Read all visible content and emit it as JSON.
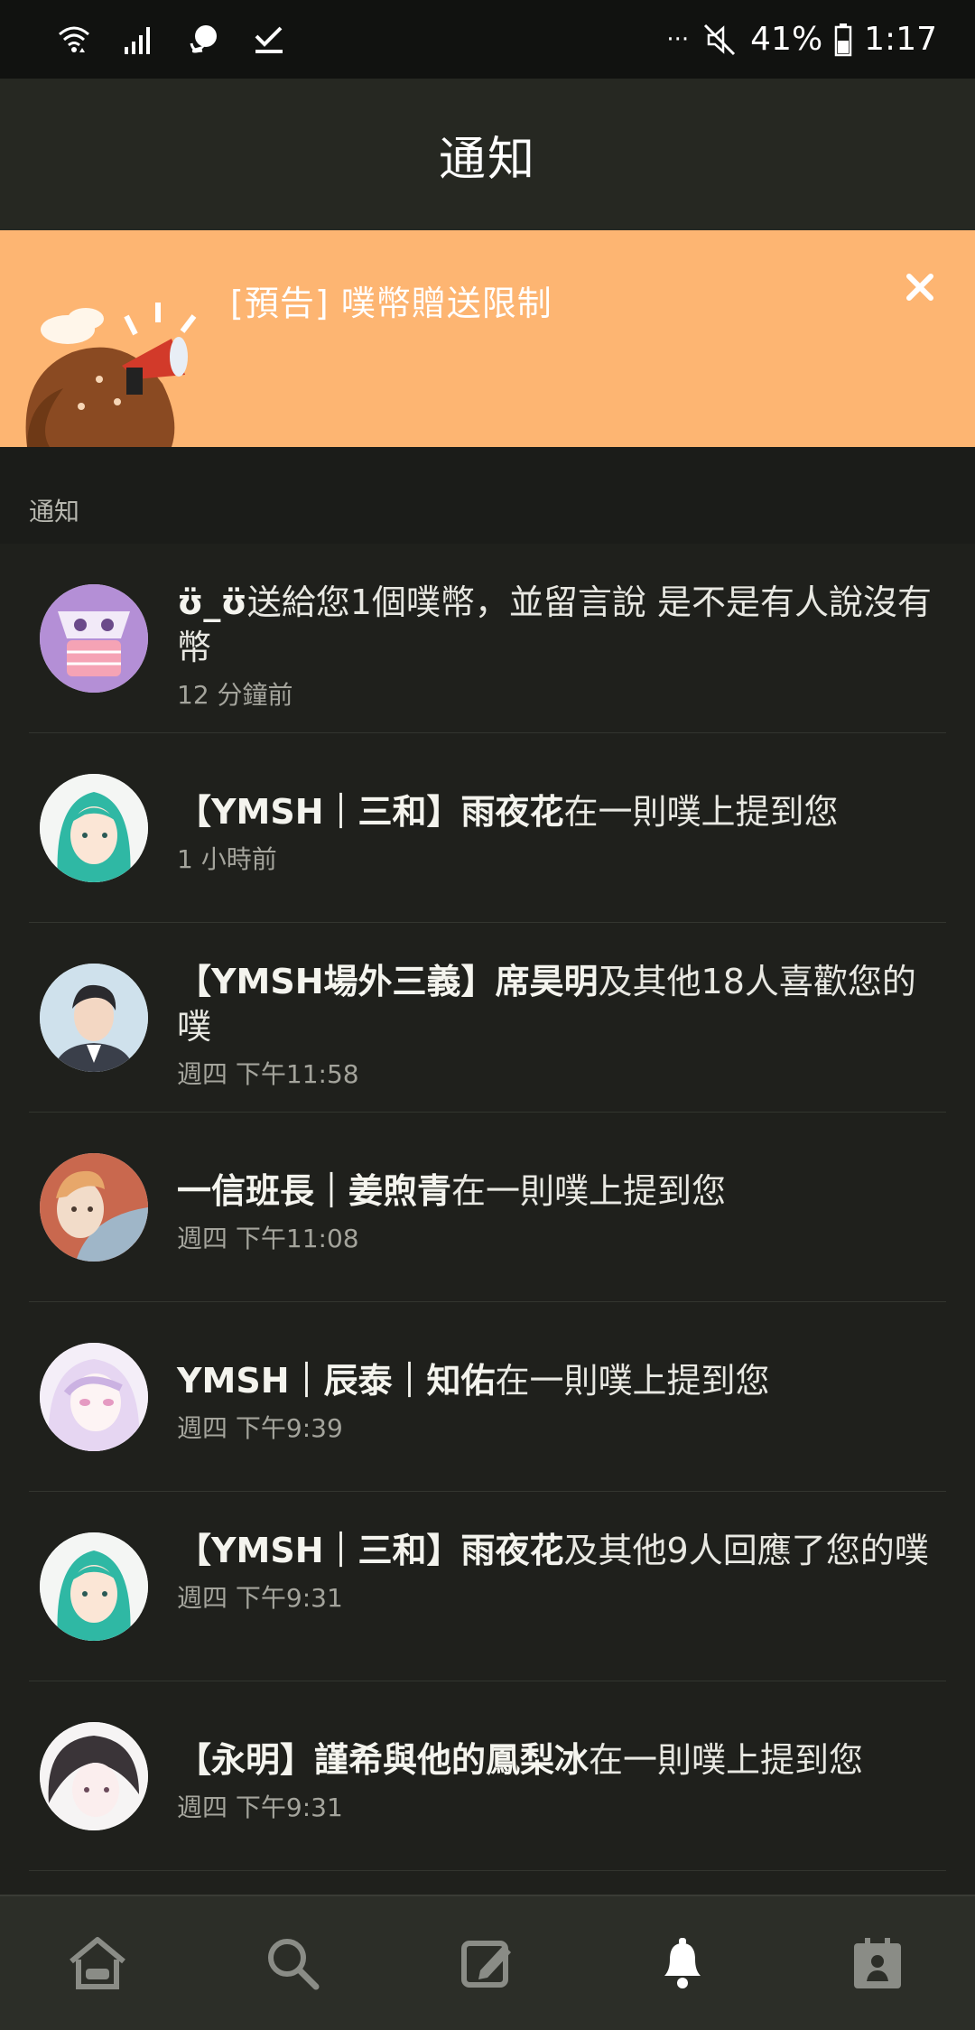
{
  "status_bar": {
    "more": "···",
    "battery": "41%",
    "time": "1:17"
  },
  "header": {
    "title": "通知"
  },
  "banner": {
    "text": "[預告] 噗幣贈送限制",
    "bg_color": "#fdb572"
  },
  "section": {
    "label": "通知"
  },
  "notifications": [
    {
      "name": "ʊ̈_ʊ̈",
      "action": "送給您1個噗幣，並留言說 是不是有人說沒有幣",
      "time": "12 分鐘前",
      "avatar": "mask-avatar"
    },
    {
      "name": "【YMSH｜三和】雨夜花",
      "action": "在一則噗上提到您",
      "time": "1 小時前",
      "avatar": "teal-hair-avatar"
    },
    {
      "name": "【YMSH場外三義】席昊明",
      "action": "及其他18人喜歡您的噗",
      "time": "週四 下午11:58",
      "avatar": "suit-man-avatar"
    },
    {
      "name": "一信班長｜姜煦青",
      "action": "在一則噗上提到您",
      "time": "週四 下午11:08",
      "avatar": "orange-hair-avatar"
    },
    {
      "name": "YMSH｜辰泰｜知佑",
      "action": "在一則噗上提到您",
      "time": "週四 下午9:39",
      "avatar": "lilac-hair-avatar"
    },
    {
      "name": "【YMSH｜三和】雨夜花",
      "action": "及其他9人回應了您的噗",
      "time": "週四 下午9:31",
      "avatar": "teal-hair-avatar"
    },
    {
      "name": "【永明】謹希與他的鳳梨冰",
      "action": "在一則噗上提到您",
      "time": "週四 下午9:31",
      "avatar": "dark-hair-avatar"
    }
  ],
  "bottom_nav": [
    {
      "icon": "home-icon",
      "active": false
    },
    {
      "icon": "search-icon",
      "active": false
    },
    {
      "icon": "compose-icon",
      "active": false
    },
    {
      "icon": "bell-icon",
      "active": true
    },
    {
      "icon": "profile-card-icon",
      "active": false
    }
  ]
}
